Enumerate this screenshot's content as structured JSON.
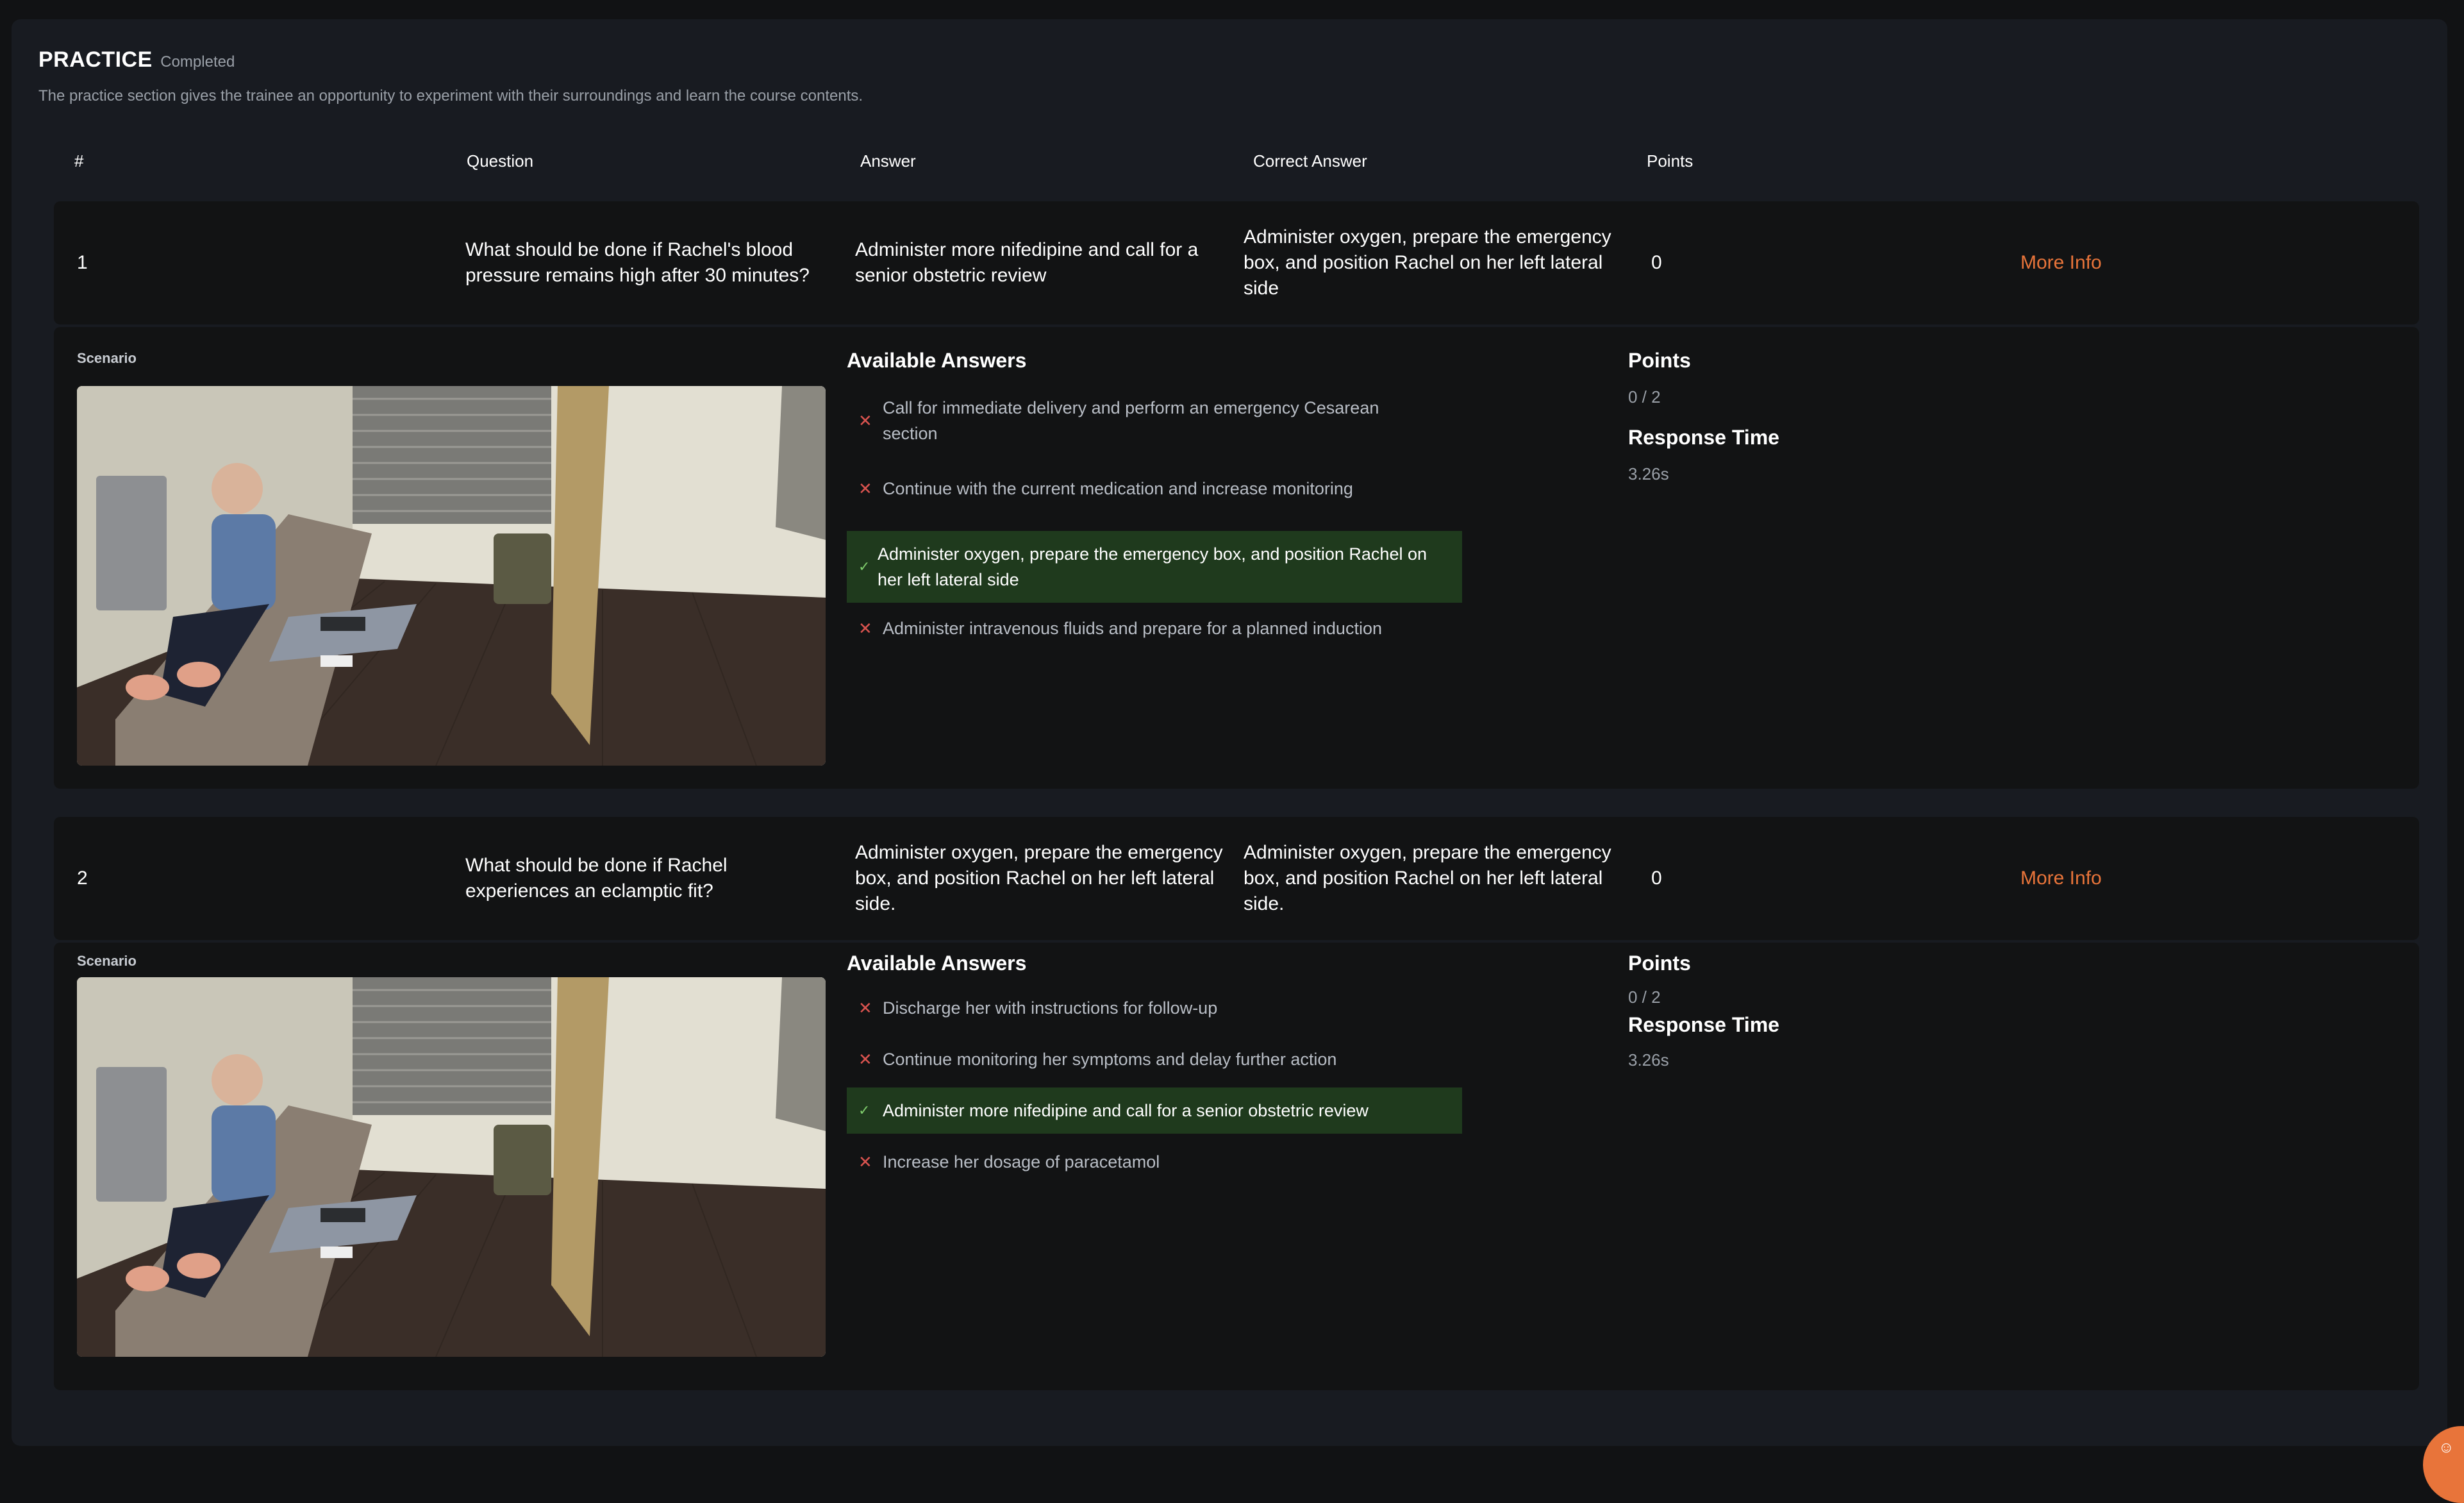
{
  "section": {
    "title": "PRACTICE",
    "status": "Completed",
    "description": "The practice section gives the trainee an opportunity to experiment with their surroundings and learn the course contents."
  },
  "columns": {
    "num": "#",
    "question": "Question",
    "answer": "Answer",
    "correct": "Correct Answer",
    "points": "Points"
  },
  "labels": {
    "scenario": "Scenario",
    "available_answers": "Available Answers",
    "points": "Points",
    "response_time": "Response Time",
    "more_info": "More Info"
  },
  "colors": {
    "accent": "#e8743a",
    "correct_bg": "#1f3a1d",
    "wrong_mark": "#d9534f",
    "correct_mark": "#7ecb6b"
  },
  "questions": [
    {
      "num": "1",
      "question": "What should be done if Rachel's blood pressure remains high after 30 minutes?",
      "answer": "Administer more nifedipine and call for a senior obstetric review",
      "correct": "Administer oxygen, prepare the emergency box, and position Rachel on her left lateral side",
      "points": "0",
      "score": "0 / 2",
      "response_time": "3.26s",
      "options": [
        {
          "text": "Call for immediate delivery and perform an emergency Cesarean section",
          "correct": false,
          "icon": "x-icon"
        },
        {
          "text": "Continue with the current medication and increase monitoring",
          "correct": false,
          "icon": "x-icon"
        },
        {
          "text": "Administer oxygen, prepare the emergency box, and position Rachel on her left lateral side",
          "correct": true,
          "icon": "check-icon"
        },
        {
          "text": "Administer intravenous fluids and prepare for a planned induction",
          "correct": false,
          "icon": "x-icon"
        }
      ]
    },
    {
      "num": "2",
      "question": "What should be done if Rachel experiences an eclamptic fit?",
      "answer": "Administer oxygen, prepare the emergency box, and position Rachel on her left lateral side.",
      "correct": "Administer oxygen, prepare the emergency box, and position Rachel on her left lateral side.",
      "points": "0",
      "score": "0 / 2",
      "response_time": "3.26s",
      "options": [
        {
          "text": "Discharge her with instructions for follow-up",
          "correct": false,
          "icon": "x-icon"
        },
        {
          "text": "Continue monitoring her symptoms and delay further action",
          "correct": false,
          "icon": "x-icon"
        },
        {
          "text": "Administer more nifedipine and call for a senior obstetric review",
          "correct": true,
          "icon": "check-icon"
        },
        {
          "text": "Increase her dosage of paracetamol",
          "correct": false,
          "icon": "x-icon"
        }
      ]
    }
  ],
  "fab_icon": "support-icon"
}
